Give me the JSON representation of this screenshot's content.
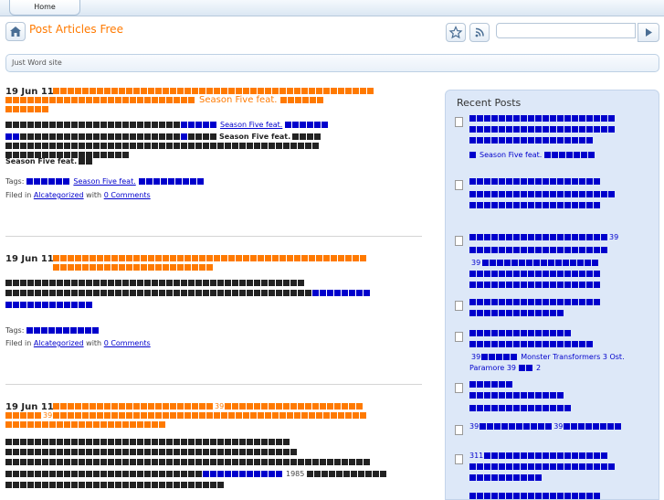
{
  "tabs": {
    "home": "Home"
  },
  "header": {
    "site_title": "Post Articles Free",
    "search_placeholder": ""
  },
  "tagline": "Just Word site",
  "posts": [
    {
      "date": "19 Jun 11",
      "title_text": "Season Five feat.",
      "link_text": "Season Five feat.",
      "body_text": "Season Five feat.",
      "body_text2": "Season Five feat.",
      "tags_label": "Tags:",
      "tag_link": "Season Five feat.",
      "filed_label": "Filed in",
      "category": "Alcategorized",
      "with_label": "with",
      "comments": "0 Comments"
    },
    {
      "date": "19 Jun 11",
      "tags_label": "Tags:",
      "filed_label": "Filed in",
      "category": "Alcategorized",
      "with_label": "with",
      "comments": "0 Comments"
    },
    {
      "date": "19 Jun 11",
      "title_num": "39",
      "title_num2": "39",
      "body_num": "1985"
    }
  ],
  "sidebar": {
    "title": "Recent Posts",
    "items": [
      {
        "text": "Season Five feat."
      },
      {
        "text": ""
      },
      {
        "text": "39",
        "text2": "39"
      },
      {
        "text": ""
      },
      {
        "text": "39",
        "text2": "Monster Transformers 3 Ost.",
        "text3": "Paramore 39",
        "text4": "2"
      },
      {
        "text": ""
      },
      {
        "text": "39",
        "text2": "39"
      },
      {
        "text": "311"
      }
    ]
  }
}
